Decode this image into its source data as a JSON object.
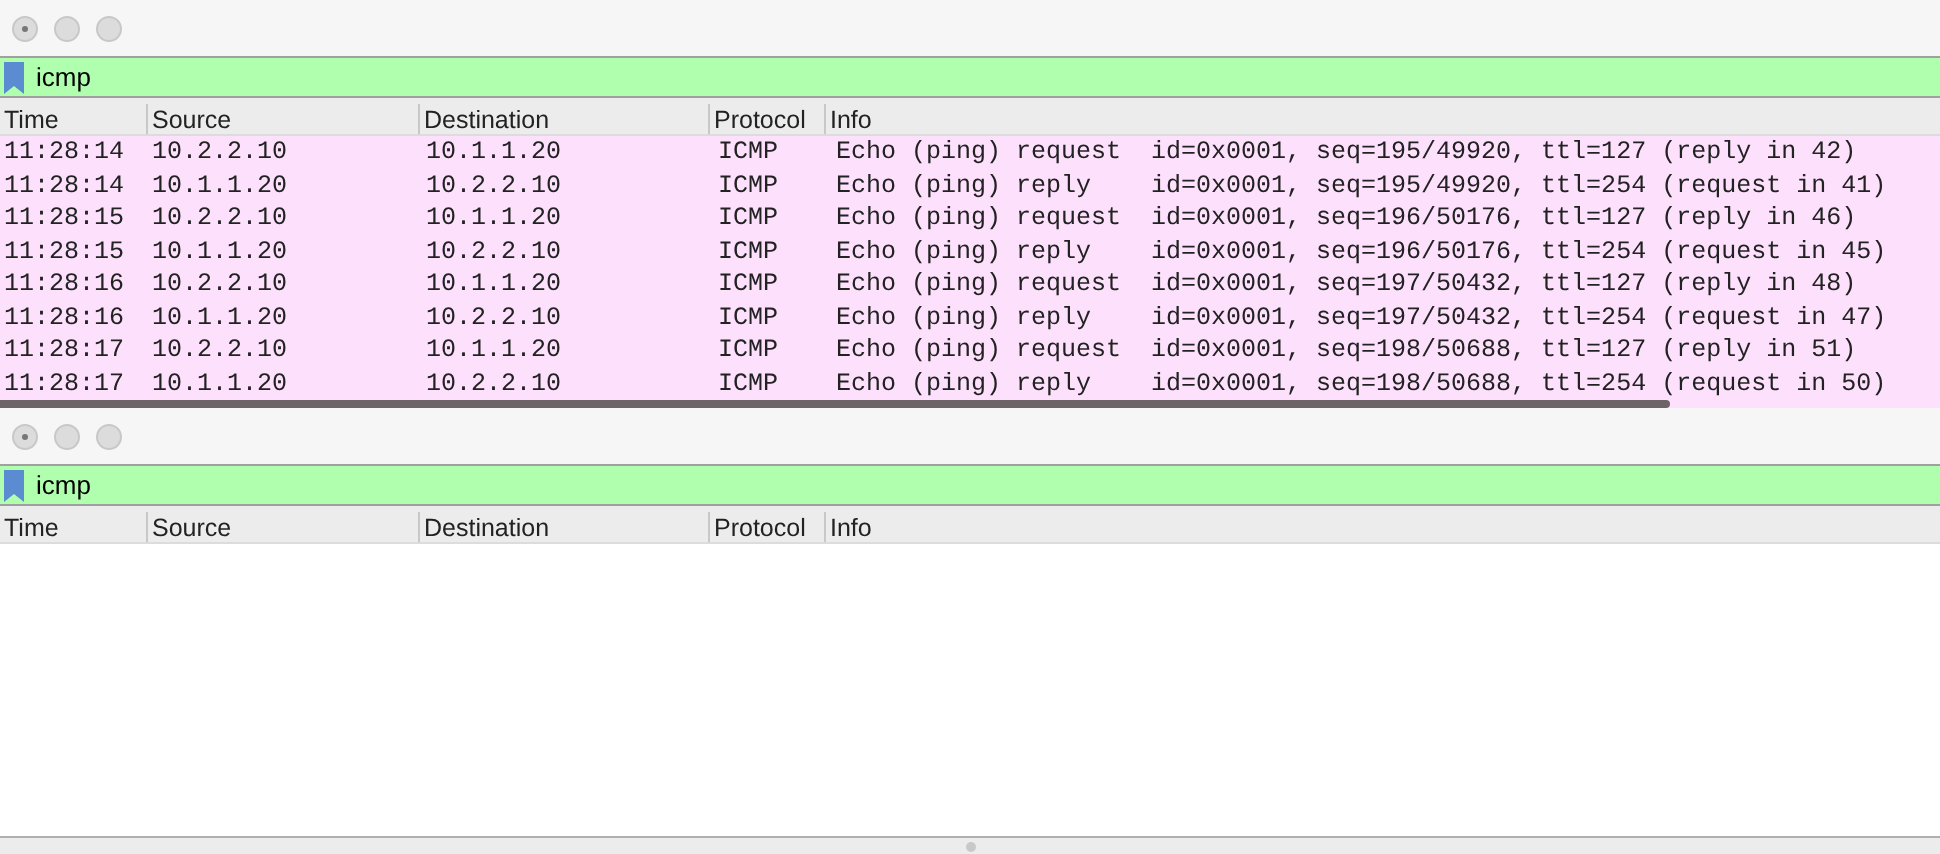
{
  "panes": [
    {
      "filter": {
        "value": "icmp"
      },
      "columns": [
        "Time",
        "Source",
        "Destination",
        "Protocol",
        "Info"
      ],
      "rows": [
        [
          "11:28:14",
          "10.2.2.10",
          "10.1.1.20",
          "ICMP",
          "Echo (ping) request  id=0x0001, seq=195/49920, ttl=127 (reply in 42)"
        ],
        [
          "11:28:14",
          "10.1.1.20",
          "10.2.2.10",
          "ICMP",
          "Echo (ping) reply    id=0x0001, seq=195/49920, ttl=254 (request in 41)"
        ],
        [
          "11:28:15",
          "10.2.2.10",
          "10.1.1.20",
          "ICMP",
          "Echo (ping) request  id=0x0001, seq=196/50176, ttl=127 (reply in 46)"
        ],
        [
          "11:28:15",
          "10.1.1.20",
          "10.2.2.10",
          "ICMP",
          "Echo (ping) reply    id=0x0001, seq=196/50176, ttl=254 (request in 45)"
        ],
        [
          "11:28:16",
          "10.2.2.10",
          "10.1.1.20",
          "ICMP",
          "Echo (ping) request  id=0x0001, seq=197/50432, ttl=127 (reply in 48)"
        ],
        [
          "11:28:16",
          "10.1.1.20",
          "10.2.2.10",
          "ICMP",
          "Echo (ping) reply    id=0x0001, seq=197/50432, ttl=254 (request in 47)"
        ],
        [
          "11:28:17",
          "10.2.2.10",
          "10.1.1.20",
          "ICMP",
          "Echo (ping) request  id=0x0001, seq=198/50688, ttl=127 (reply in 51)"
        ],
        [
          "11:28:17",
          "10.1.1.20",
          "10.2.2.10",
          "ICMP",
          "Echo (ping) reply    id=0x0001, seq=198/50688, ttl=254 (request in 50)"
        ]
      ]
    },
    {
      "filter": {
        "value": "icmp"
      },
      "columns": [
        "Time",
        "Source",
        "Destination",
        "Protocol",
        "Info"
      ]
    }
  ]
}
